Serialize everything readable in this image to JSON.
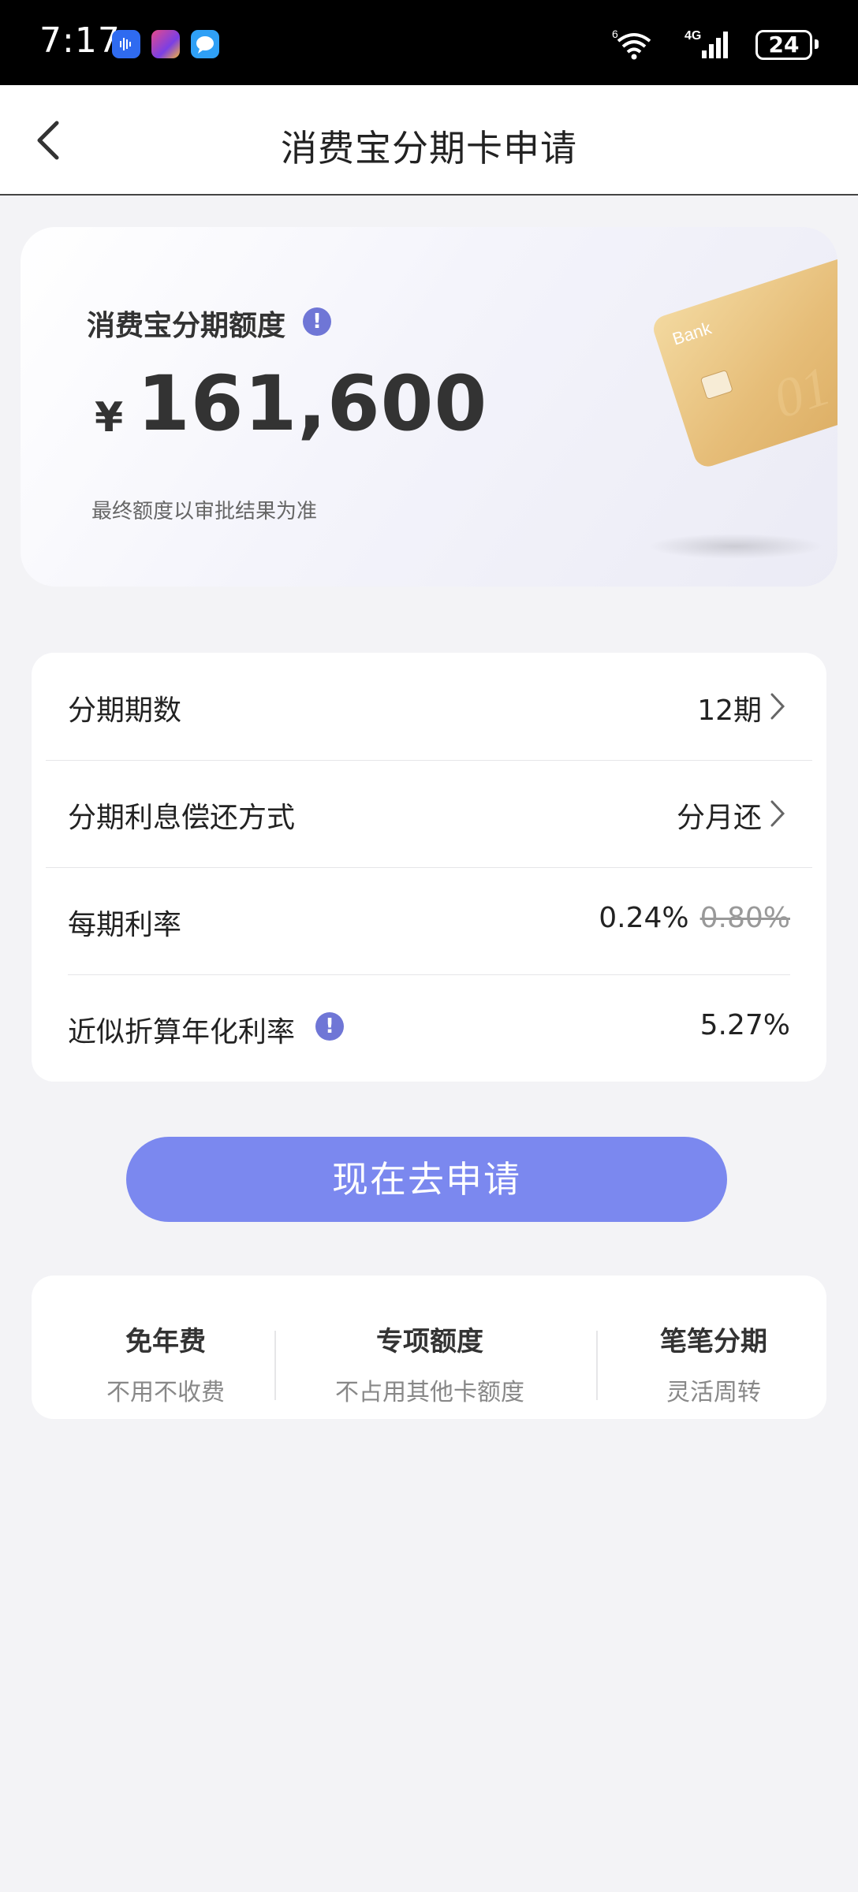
{
  "status_bar": {
    "time": "7:17",
    "network": "4G",
    "wifi_superscript": "6",
    "battery": "24",
    "icons": [
      "voice-assistant-icon",
      "game-app-icon",
      "message-app-icon",
      "wifi-icon",
      "signal-icon",
      "battery-icon"
    ]
  },
  "nav": {
    "title": "消费宝分期卡申请",
    "back_icon": "chevron-left-icon"
  },
  "hero": {
    "label": "消费宝分期额度",
    "currency": "¥",
    "amount": "161,600",
    "note": "最终额度以审批结果为准",
    "info_icon": "!",
    "card_text": "Bank"
  },
  "rows": [
    {
      "label": "分期期数",
      "value": "12期"
    },
    {
      "label": "分期利息偿还方式",
      "value": "分月还"
    },
    {
      "label": "每期利率",
      "value": "0.24%",
      "original": "0.80%"
    },
    {
      "label": "近似折算年化利率",
      "value": "5.27%",
      "info_icon": "!"
    }
  ],
  "apply_button": "现在去申请",
  "benefits": [
    {
      "title": "免年费",
      "subtitle": "不用不收费"
    },
    {
      "title": "专项额度",
      "subtitle": "不占用其他卡额度"
    },
    {
      "title": "笔笔分期",
      "subtitle": "灵活周转"
    }
  ],
  "colors": {
    "accent": "#7b88ef",
    "info_icon": "#6f76d6",
    "background": "#f3f3f6"
  }
}
